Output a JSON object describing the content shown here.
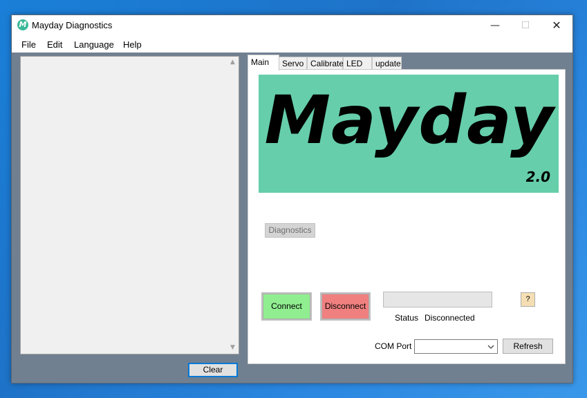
{
  "window": {
    "title": "Mayday Diagnostics",
    "icon_letter": "M",
    "controls": {
      "minimize": "—",
      "maximize": "☐",
      "close": "✕"
    }
  },
  "menu": [
    "File",
    "Edit",
    "Language",
    "Help"
  ],
  "log_panel": {
    "clear_label": "Clear",
    "scroll_up": "▲",
    "scroll_down": "▼"
  },
  "tabs": [
    "Main",
    "Servo",
    "Calibrate",
    "LED",
    "update"
  ],
  "active_tab": "Main",
  "main": {
    "banner_title": "Mayday",
    "banner_version": "2.0",
    "diagnostics_label": "Diagnostics",
    "connect_label": "Connect",
    "disconnect_label": "Disconnect",
    "help_label": "?",
    "status_label": "Status",
    "status_value": "Disconnected",
    "com_port_label": "COM Port",
    "com_port_value": "",
    "refresh_label": "Refresh"
  },
  "colors": {
    "banner": "#66ceaa",
    "connect": "#90ee90",
    "disconnect": "#f08080",
    "help_button": "#f5deb3",
    "window_bg": "#708090"
  }
}
